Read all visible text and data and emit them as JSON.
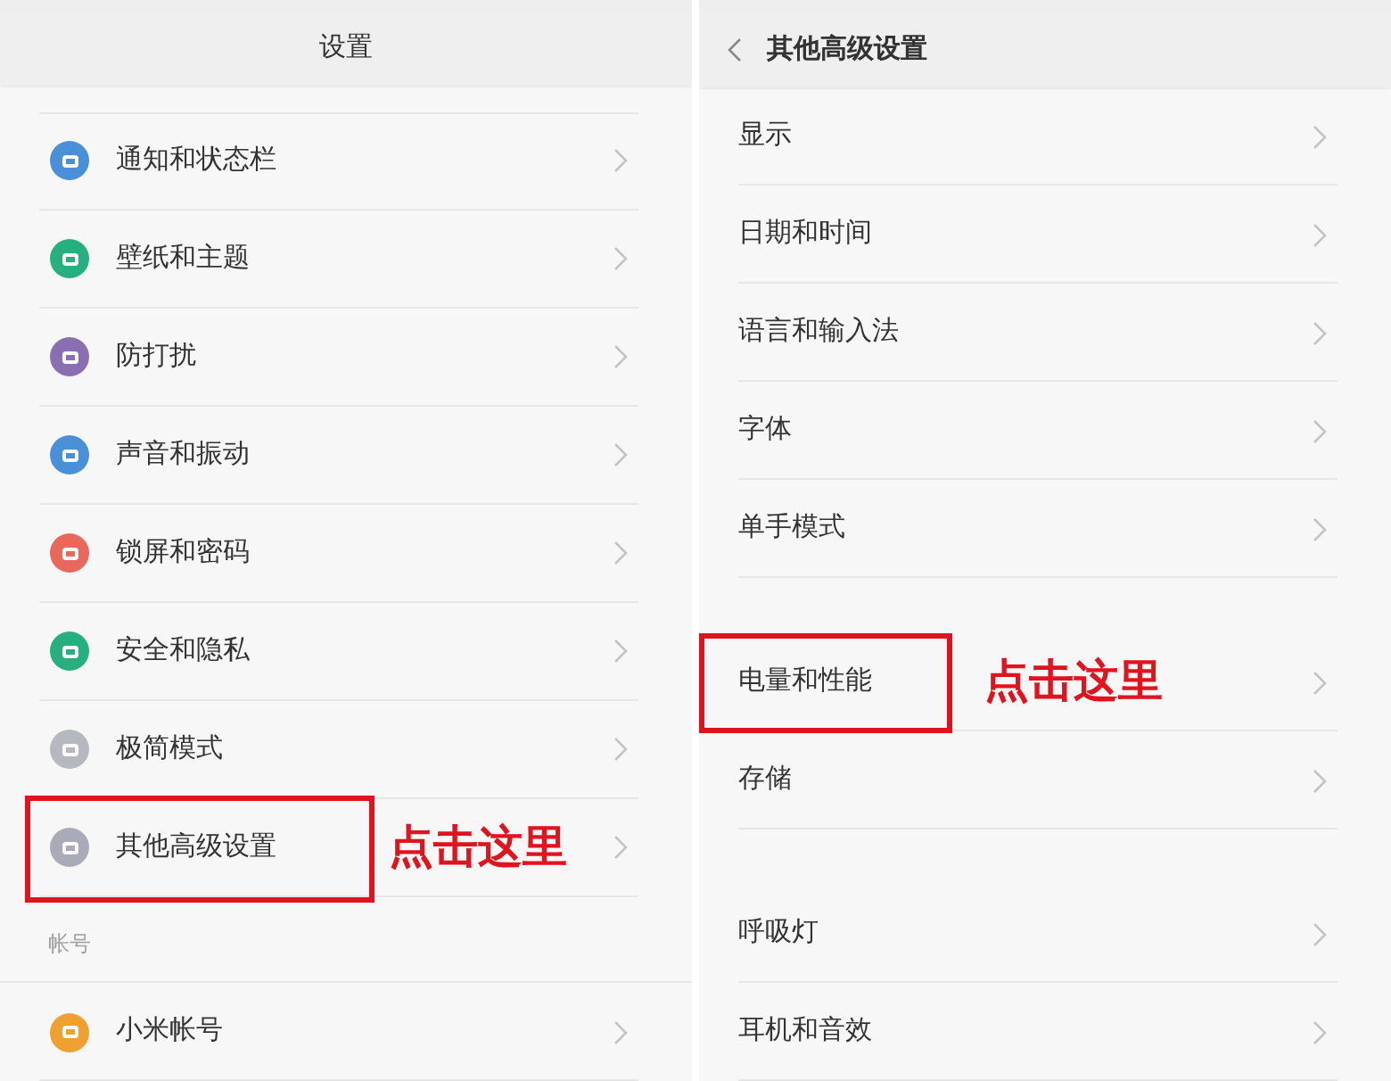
{
  "panels": [
    {
      "title": "设置",
      "back": false,
      "sections": [
        {
          "items": [
            {
              "label": "通知和状态栏",
              "color": "#4a90d9",
              "highlighted": false
            },
            {
              "label": "壁纸和主题",
              "color": "#26b07f",
              "highlighted": false
            },
            {
              "label": "防打扰",
              "color": "#8a6fb0",
              "highlighted": false
            },
            {
              "label": "声音和振动",
              "color": "#4a90d9",
              "highlighted": false
            },
            {
              "label": "锁屏和密码",
              "color": "#e8685c",
              "highlighted": false
            },
            {
              "label": "安全和隐私",
              "color": "#26b07f",
              "highlighted": false
            },
            {
              "label": "极简模式",
              "color": "#b5b8bf",
              "highlighted": false
            },
            {
              "label": "其他高级设置",
              "color": "#a9acb8",
              "highlighted": true,
              "annotation": "点击这里"
            }
          ]
        },
        {
          "label": "帐号",
          "items": [
            {
              "label": "小米帐号",
              "color": "#f0a030",
              "highlighted": false
            }
          ]
        }
      ]
    },
    {
      "title": "其他高级设置",
      "back": true,
      "sections": [
        {
          "items": [
            {
              "label": "显示",
              "highlighted": false
            },
            {
              "label": "日期和时间",
              "highlighted": false
            },
            {
              "label": "语言和输入法",
              "highlighted": false
            },
            {
              "label": "字体",
              "highlighted": false
            },
            {
              "label": "单手模式",
              "highlighted": false
            }
          ]
        },
        {
          "items": [
            {
              "label": "电量和性能",
              "highlighted": true,
              "annotation": "点击这里"
            },
            {
              "label": "存储",
              "highlighted": false
            }
          ]
        },
        {
          "items": [
            {
              "label": "呼吸灯",
              "highlighted": false
            },
            {
              "label": "耳机和音效",
              "highlighted": false
            }
          ]
        }
      ]
    }
  ]
}
